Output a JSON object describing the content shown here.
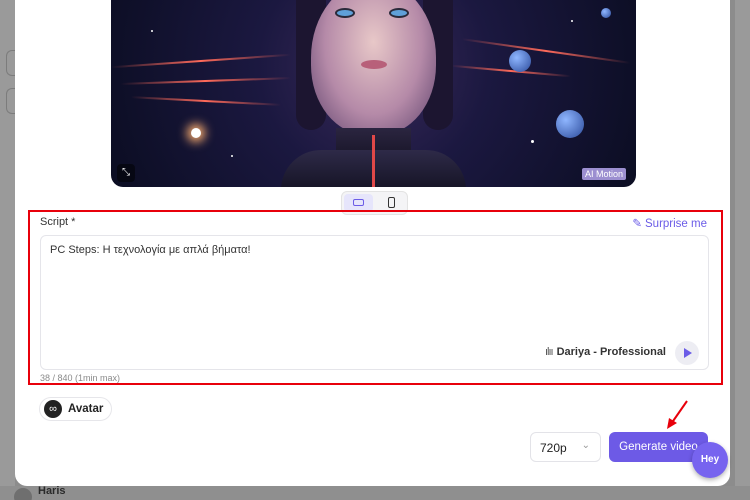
{
  "preview": {
    "badge": "AI Motion",
    "expand_icon": "expand-icon"
  },
  "aspect": {
    "options": [
      "landscape",
      "portrait"
    ],
    "selected": "landscape"
  },
  "script": {
    "label": "Script *",
    "surprise_label": "Surprise me",
    "text": "PC Steps: Η τεχνολογία με απλά βήματα!",
    "voice": "Dariya - Professional",
    "counter": "38 / 840 (1min max)"
  },
  "avatar": {
    "label": "Avatar"
  },
  "resolution": {
    "value": "720p"
  },
  "generate_label": "Generate video",
  "chat": {
    "label": "Hey"
  },
  "background": {
    "user_name": "Haris"
  },
  "colors": {
    "accent": "#6d5ae6",
    "highlight": "#e8000b"
  }
}
